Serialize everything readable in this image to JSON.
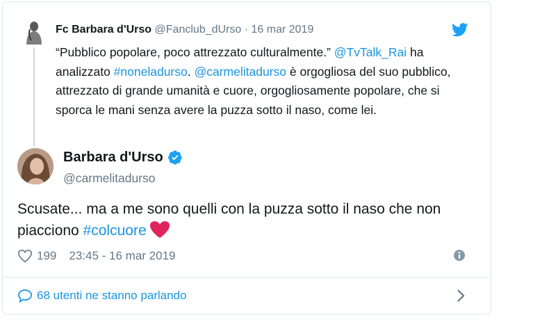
{
  "parent_tweet": {
    "display_name": "Fc Barbara d'Urso",
    "handle": "@Fanclub_dUrso",
    "separator": "·",
    "date": "16 mar 2019",
    "text_1": "“Pubblico popolare, poco attrezzato culturalmente.” ",
    "mention_1": "@TvTalk_Rai",
    "text_2": " ha analizzato ",
    "hashtag_1": "#noneladurso",
    "text_3": ". ",
    "mention_2": "@carmelitadurso",
    "text_4": " è orgogliosa del suo pubblico, attrezzato di grande umanità e cuore, orgogliosamente popolare, che si sporca le mani senza avere la puzza sotto il naso, come lei."
  },
  "main_tweet": {
    "display_name": "Barbara d'Urso",
    "handle": "@carmelitadurso",
    "text": "Scusate... ma a me sono quelli con la puzza sotto il naso che non piacciono ",
    "hashtag": "#colcuore",
    "likes": "199",
    "timestamp": "23:45 - 16 mar 2019"
  },
  "footer": {
    "conversation_label": "68 utenti ne stanno parlando"
  },
  "icons": {
    "brand": "twitter-bird-icon",
    "verified": "verified-badge-icon",
    "like": "heart-outline-icon",
    "emoji": "red-heart-emoji",
    "info": "info-icon",
    "conversation": "speech-bubble-icon",
    "chevron": "chevron-right-icon"
  },
  "colors": {
    "link": "#1b95e0",
    "muted": "#657786",
    "text": "#14171a",
    "heart_emoji": "#e0245e",
    "border": "#e1e8ed"
  }
}
